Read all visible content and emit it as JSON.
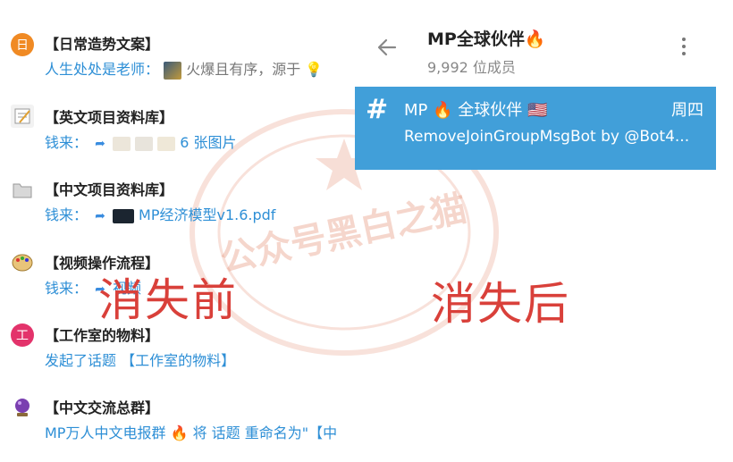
{
  "chats": [
    {
      "title": "【日常造势文案】",
      "prefix": "",
      "text": "人生处处是老师：",
      "extra": "火爆且有序，源于",
      "icon": "calendar-icon",
      "icon_text": "日",
      "icon_color": "#f08a24"
    },
    {
      "title": "【英文项目资料库】",
      "prefix": "钱来：",
      "text": "6 张图片",
      "extra": "",
      "icon": "memo-icon",
      "icon_text": "",
      "icon_color": ""
    },
    {
      "title": "【中文项目资料库】",
      "prefix": "钱来：",
      "text": "MP经济模型v1.6.pdf",
      "extra": "",
      "icon": "folder-icon",
      "icon_text": "",
      "icon_color": ""
    },
    {
      "title": "【视频操作流程】",
      "prefix": "钱来：",
      "text": "视频",
      "extra": "",
      "icon": "palette-icon",
      "icon_text": "",
      "icon_color": ""
    },
    {
      "title": "【工作室的物料】",
      "prefix": "",
      "text": "发起了话题 【工作室的物料】",
      "extra": "",
      "icon": "work-icon",
      "icon_text": "工",
      "icon_color": "#e3336b"
    },
    {
      "title": "【中文交流总群】",
      "prefix": "",
      "text": "MP万人中文电报群",
      "extra": "将 话题 重命名为\"【中",
      "icon": "crystal-ball-icon",
      "icon_text": "",
      "icon_color": ""
    }
  ],
  "group": {
    "title": "MP全球伙伴",
    "members": "9,992 位成员"
  },
  "selected": {
    "name": "MP 🔥 全球伙伴 🇺🇸",
    "day": "周四",
    "message": "RemoveJoinGroupMsgBot by @Bot4..."
  },
  "labels": {
    "before": "消失前",
    "after": "消失后",
    "watermark": "公众号黑白之猫"
  },
  "colors": {
    "accent": "#419fd9",
    "link": "#2e8fd6",
    "label_red": "#d9403a"
  }
}
